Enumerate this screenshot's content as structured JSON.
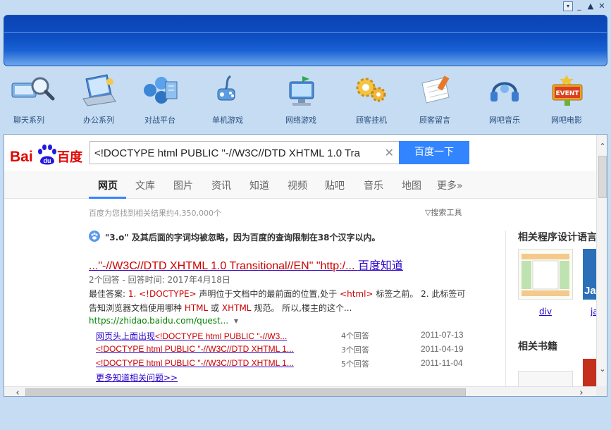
{
  "window": {
    "buttons": [
      "▾",
      "_",
      "▲",
      "✕"
    ]
  },
  "toolbar": {
    "items": [
      {
        "label": "聊天系列",
        "icon": "chat-magnifier-icon"
      },
      {
        "label": "办公系列",
        "icon": "office-laptop-icon"
      },
      {
        "label": "对战平台",
        "icon": "battle-network-icon"
      },
      {
        "label": "单机游戏",
        "icon": "gamepad-icon"
      },
      {
        "label": "网络游戏",
        "icon": "online-game-monitor-icon"
      },
      {
        "label": "顾客挂机",
        "icon": "gears-icon"
      },
      {
        "label": "顾客留言",
        "icon": "notepad-icon"
      },
      {
        "label": "网吧音乐",
        "icon": "headphones-icon"
      },
      {
        "label": "网吧电影",
        "icon": "event-sign-icon"
      }
    ]
  },
  "search": {
    "query": "<!DOCTYPE html PUBLIC \"-//W3C//DTD XHTML 1.0 Tra",
    "button_label": "百度一下",
    "clear_icon": "✕"
  },
  "tabs": [
    "网页",
    "文库",
    "图片",
    "资讯",
    "知道",
    "视频",
    "贴吧",
    "音乐",
    "地图",
    "更多»"
  ],
  "results_count": "百度为您找到相关结果约4,350,000个",
  "search_tools": "搜索工具",
  "hint": "\"3.o\" 及其后面的字词均被忽略，因为百度的查询限制在38个汉字以内。",
  "result": {
    "title_pre": "...\"-//W3C//DTD XHTML 1.0 Transitional//EN\" \"http:/...",
    "title_source": "百度知道",
    "meta": "2个回答 - 回答时间: 2017年4月18日",
    "abstract_label": "最佳答案:",
    "abstract_1": " 1. ",
    "abstract_hl1": "<!DOCTYPE>",
    "abstract_2": " 声明位于文档中的最前面的位置,处于 ",
    "abstract_hl2": "<html>",
    "abstract_3": " 标签之前。 2. 此标签可告知浏览器文档使用哪种 ",
    "abstract_hl3": "HTML",
    "abstract_4": " 或 ",
    "abstract_hl4": "XHTML",
    "abstract_5": " 规范。 所以,楼主的这个...",
    "url": "https://zhidao.baidu.com/quest...",
    "url_caret": "▾"
  },
  "sub_results": [
    {
      "pre": "网页头上面出现",
      "hl": "<!DOCTYPE html PUBLIC \"-//W3...",
      "count": "4个回答",
      "date": "2011-07-13"
    },
    {
      "pre": "",
      "hl": "<!DOCTYPE html PUBLIC \"-//W3C//DTD XHTML 1...",
      "count": "3个回答",
      "date": "2011-04-19"
    },
    {
      "pre": "",
      "hl": "<!DOCTYPE html PUBLIC \"-//W3C//DTD XHTML 1...",
      "count": "5个回答",
      "date": "2011-11-04"
    }
  ],
  "more_link": "更多知道相关问题>>",
  "sidebar": {
    "heading1": "相关程序设计语言",
    "items": [
      {
        "label": "div"
      },
      {
        "label": "ja"
      }
    ],
    "thumb_text": "Jav",
    "heading2": "相关书籍"
  },
  "colors": {
    "accent": "#3385ff",
    "link": "#2a00cc",
    "highlight": "#cc0000",
    "url": "#008000",
    "banner": "#0d4fc3"
  }
}
